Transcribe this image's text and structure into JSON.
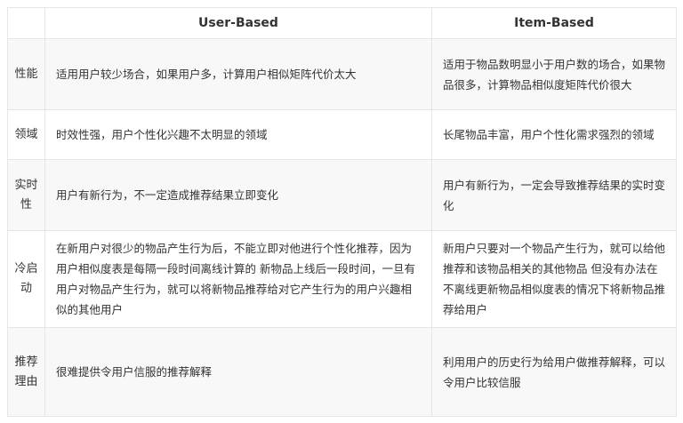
{
  "table": {
    "headers": {
      "corner": "",
      "user_based": "User-Based",
      "item_based": "Item-Based"
    },
    "rows": [
      {
        "label": "性能",
        "user_based": "适用用户较少场合，如果用户多，计算用户相似矩阵代价太大",
        "item_based": "适用于物品数明显小于用户数的场合，如果物品很多，计算物品相似度矩阵代价很大"
      },
      {
        "label": "领域",
        "user_based": "时效性强，用户个性化兴趣不太明显的领域",
        "item_based": "长尾物品丰富，用户个性化需求强烈的领域"
      },
      {
        "label": "实时性",
        "user_based": "用户有新行为，不一定造成推荐结果立即变化",
        "item_based": "用户有新行为，一定会导致推荐结果的实时变化"
      },
      {
        "label": "冷启动",
        "user_based": "在新用户对很少的物品产生行为后，不能立即对他进行个性化推荐，因为用户相似度表是每隔一段时间离线计算的 新物品上线后一段时间，一旦有用户对物品产生行为，就可以将新物品推荐给对它产生行为的用户兴趣相似的其他用户",
        "item_based": "新用户只要对一个物品产生行为，就可以给他推荐和该物品相关的其他物品 但没有办法在不离线更新物品相似度表的情况下将新物品推荐给用户"
      },
      {
        "label": "推荐理由",
        "user_based": "很难提供令用户信服的推荐解释",
        "item_based": "利用用户的历史行为给用户做推荐解释，可以令用户比较信服"
      }
    ]
  }
}
